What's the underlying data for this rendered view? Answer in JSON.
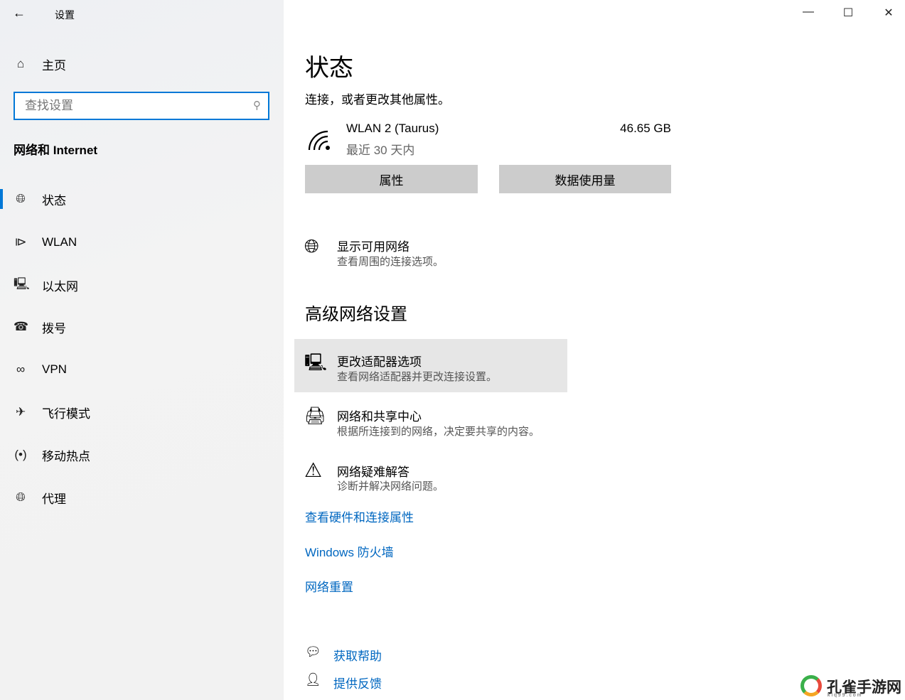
{
  "window": {
    "title": "设置",
    "back_icon": "arrow-left-icon",
    "minimize_icon": "minimize-icon",
    "maximize_icon": "maximize-icon",
    "close_icon": "close-icon"
  },
  "sidebar": {
    "home": "主页",
    "search_placeholder": "查找设置",
    "section": "网络和 Internet",
    "items": [
      {
        "label": "状态",
        "icon": "globe-status-icon",
        "selected": true
      },
      {
        "label": "WLAN",
        "icon": "wifi-icon"
      },
      {
        "label": "以太网",
        "icon": "ethernet-icon"
      },
      {
        "label": "拨号",
        "icon": "dialup-icon"
      },
      {
        "label": "VPN",
        "icon": "vpn-icon"
      },
      {
        "label": "飞行模式",
        "icon": "airplane-icon"
      },
      {
        "label": "移动热点",
        "icon": "hotspot-icon"
      },
      {
        "label": "代理",
        "icon": "globe-icon"
      }
    ],
    "accent": "#0078d7"
  },
  "main": {
    "title": "状态",
    "desc_tail": "连接，或者更改其他属性。",
    "network": {
      "name": "WLAN 2 (Taurus)",
      "period": "最近 30 天内",
      "usage": "46.65 GB"
    },
    "buttons": {
      "properties": "属性",
      "data_usage": "数据使用量"
    },
    "show_networks": {
      "title": "显示可用网络",
      "subtitle": "查看周围的连接选项。"
    },
    "advanced_heading": "高级网络设置",
    "advanced": [
      {
        "title": "更改适配器选项",
        "subtitle": "查看网络适配器并更改连接设置。",
        "icon": "adapter-icon"
      },
      {
        "title": "网络和共享中心",
        "subtitle": "根据所连接到的网络，决定要共享的内容。",
        "icon": "sharing-center-icon"
      },
      {
        "title": "网络疑难解答",
        "subtitle": "诊断并解决网络问题。",
        "icon": "warning-icon"
      }
    ],
    "links": [
      "查看硬件和连接属性",
      "Windows 防火墙",
      "网络重置"
    ],
    "help": {
      "get_help": "获取帮助",
      "feedback": "提供反馈"
    },
    "link_color": "#0067c0"
  },
  "watermark": {
    "text": "孔雀手游网",
    "sub": "k l q 9 9 . c o m"
  }
}
